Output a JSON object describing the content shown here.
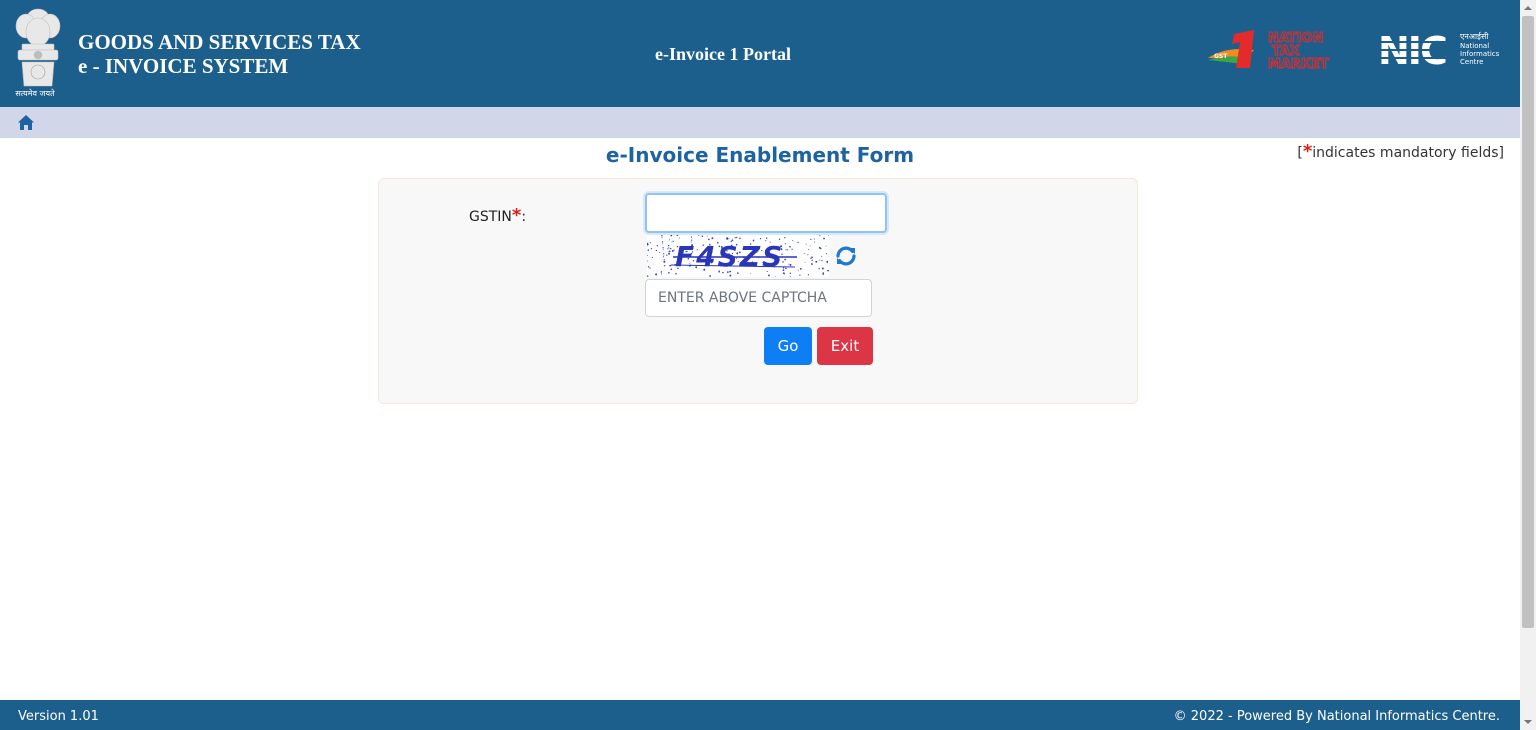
{
  "header": {
    "org_title_line1": "GOODS AND SERVICES TAX",
    "org_title_line2": "e - INVOICE SYSTEM",
    "emblem_caption": "सत्यमेव जयते",
    "portal_title": "e-Invoice 1 Portal",
    "ntm_logo_text": [
      "NATION",
      "TAX",
      "MARKET"
    ],
    "ntm_badge": "GST",
    "nic_logo": {
      "acronym": "NIC",
      "hindi": "एनआईसी",
      "line1": "National",
      "line2": "Informatics",
      "line3": "Centre"
    }
  },
  "nav": {
    "home_icon": "home-icon"
  },
  "form": {
    "title": "e-Invoice Enablement Form",
    "mandatory_note_prefix": "[",
    "mandatory_star": "*",
    "mandatory_note_text": "indicates mandatory fields]",
    "gstin_label": "GSTIN",
    "gstin_star": "*",
    "gstin_colon": ":",
    "gstin_value": "",
    "captcha_text": "F4SZS",
    "captcha_placeholder": "ENTER ABOVE CAPTCHA",
    "go_label": "Go",
    "exit_label": "Exit"
  },
  "footer": {
    "version": "Version 1.01",
    "copyright": "© 2022 - Powered By National Informatics Centre."
  },
  "colors": {
    "header_bg": "#1c5f8c",
    "nav_bg": "#d1d6e9",
    "title_blue": "#1d63a2",
    "go_blue": "#0d7ef3",
    "exit_red": "#dc3545",
    "required_red": "#e01b1b"
  }
}
